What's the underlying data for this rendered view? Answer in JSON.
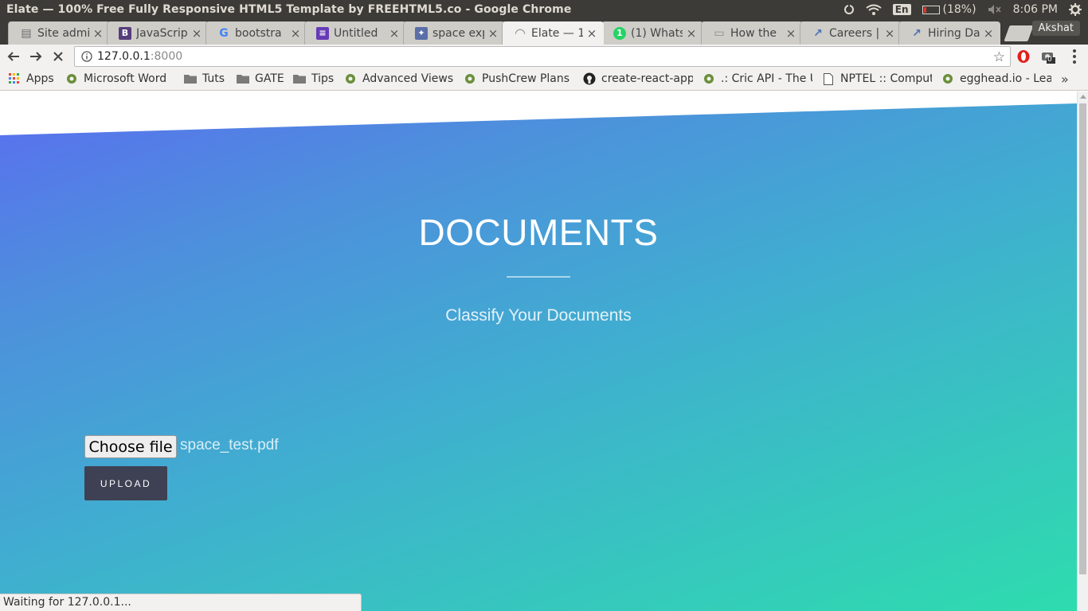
{
  "os": {
    "window_title": "Elate — 100% Free Fully Responsive HTML5 Template by FREEHTML5.co - Google Chrome",
    "lang": "En",
    "battery": "(18%)",
    "battery_level": 0.18,
    "time": "8:06 PM"
  },
  "tabs": [
    {
      "label": "Site admi",
      "icon": "document-icon",
      "color": "#6b6b6b"
    },
    {
      "label": "JavaScrip",
      "icon": "bootstrap-icon",
      "color": "#563d7c"
    },
    {
      "label": "bootstra",
      "icon": "google-icon",
      "color": "#4285f4"
    },
    {
      "label": "Untitled",
      "icon": "forms-icon",
      "color": "#673ab7"
    },
    {
      "label": "space exp",
      "icon": "space-icon",
      "color": "#5a6fa8"
    },
    {
      "label": "Elate — 1",
      "icon": "loading-icon",
      "color": "#888888",
      "active": true
    },
    {
      "label": "(1) Whats",
      "icon": "whatsapp-icon",
      "color": "#25d366"
    },
    {
      "label": "How the",
      "icon": "page-icon",
      "color": "#8a8a8a"
    },
    {
      "label": "Careers |",
      "icon": "chart-icon",
      "color": "#4a6fb5"
    },
    {
      "label": "Hiring Da",
      "icon": "chart-icon",
      "color": "#4a6fb5"
    }
  ],
  "profile": "Akshat",
  "address": {
    "host": "127.0.0.1",
    "port": ":8000"
  },
  "extension_badge": "0",
  "bookmarks": [
    {
      "label": "Apps",
      "icon": "apps-grid-icon"
    },
    {
      "label": "Microsoft Word",
      "icon": "site-icon"
    },
    {
      "label": "Tuts",
      "icon": "folder-icon"
    },
    {
      "label": "GATE",
      "icon": "folder-icon"
    },
    {
      "label": "Tips",
      "icon": "folder-icon"
    },
    {
      "label": "Advanced Views",
      "icon": "site-icon"
    },
    {
      "label": "PushCrew Plans",
      "icon": "site-icon"
    },
    {
      "label": "create-react-app",
      "icon": "github-icon"
    },
    {
      "label": ".: Cric API - The U",
      "icon": "site-icon"
    },
    {
      "label": "NPTEL :: Comput",
      "icon": "page-icon"
    },
    {
      "label": "egghead.io - Lea",
      "icon": "site-icon"
    }
  ],
  "page": {
    "title": "DOCUMENTS",
    "subtitle": "Classify Your Documents",
    "file_button": "Choose file",
    "file_name": "space_test.pdf",
    "upload_button": "UPLOAD"
  },
  "status": "Waiting for 127.0.0.1..."
}
